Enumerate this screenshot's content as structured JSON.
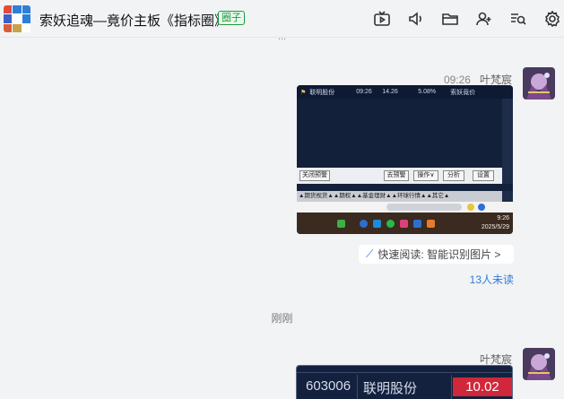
{
  "header": {
    "title": "索妖追魂—竟价主板《指标圈》",
    "tag": "圈子",
    "avatar_chars": [
      "订",
      "索",
      "",
      "流",
      "",
      "",
      "",
      "",
      ""
    ]
  },
  "scroll_cut_text": "...",
  "message1": {
    "time": "09:26",
    "sender": "叶梵宸",
    "screenshot": {
      "top_row": [
        "联明股份",
        "09:26",
        "14.26",
        "5.08%",
        "索妖竟价"
      ],
      "buttons": [
        "关闭预警",
        "去预警",
        "操作∨",
        "分析",
        "设置"
      ],
      "tabs": "▲期货规货▲▲期权▲▲基金理财▲▲环球行情▲▲其它▲",
      "clock_time": "9:26",
      "clock_date": "2025/5/29"
    },
    "quick_read": "快速阅读: 智能识别图片 >",
    "unread": "13人未读"
  },
  "time_divider": "刚刚",
  "message2": {
    "sender": "叶梵宸",
    "stock": {
      "code": "603006",
      "name": "联明股份",
      "price": "10.02"
    }
  },
  "colors": {
    "accent_link": "#2f7bd9",
    "tag_green": "#1a9c3c",
    "price_red": "#d1273a",
    "card_navy": "#13213f"
  }
}
